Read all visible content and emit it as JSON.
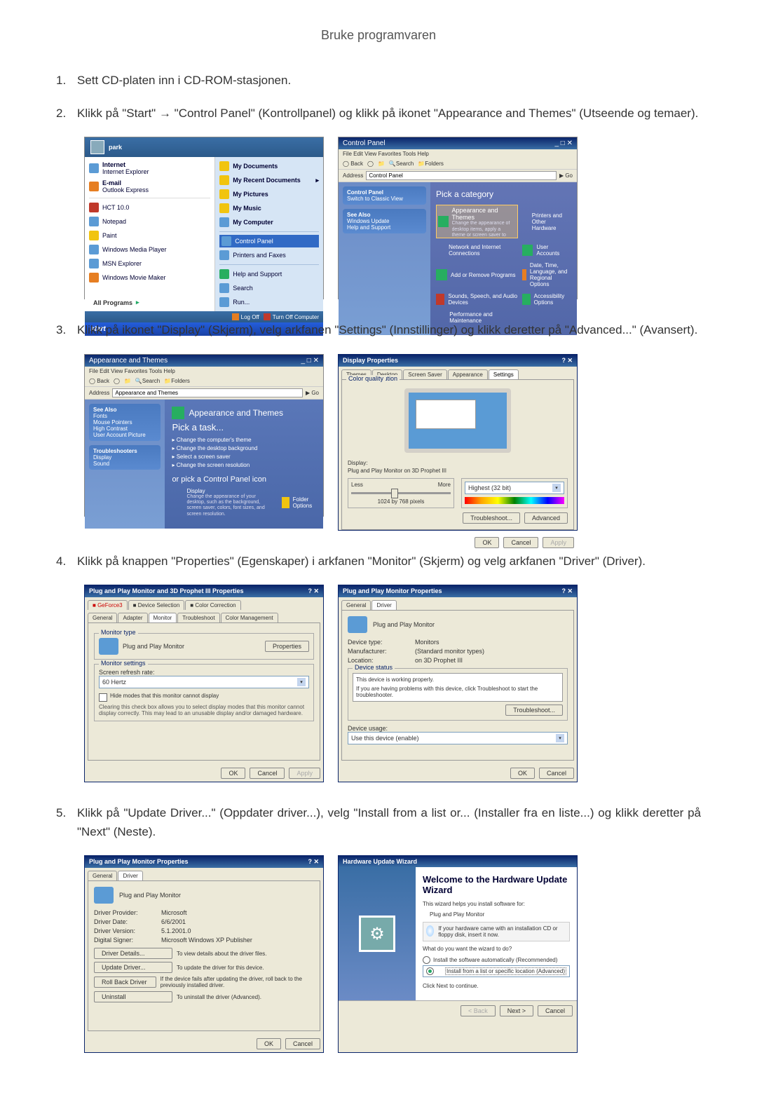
{
  "page_title": "Bruke programvaren",
  "steps": [
    {
      "num": "1.",
      "text": "Sett CD-platen inn i CD-ROM-stasjonen."
    },
    {
      "num": "2.",
      "text": "Klikk på \"Start\" → \"Control Panel\" (Kontrollpanel) og klikk på ikonet \"Appearance and Themes\" (Utseende og temaer)."
    },
    {
      "num": "3.",
      "text": "Klikk på ikonet \"Display\" (Skjerm), velg arkfanen \"Settings\" (Innstillinger) og klikk deretter på \"Advanced...\" (Avansert)."
    },
    {
      "num": "4.",
      "text": "Klikk på knappen \"Properties\" (Egenskaper) i arkfanen \"Monitor\" (Skjerm) og velg arkfanen \"Driver\" (Driver)."
    },
    {
      "num": "5.",
      "text": "Klikk på \"Update Driver...\" (Oppdater driver...), velg \"Install from a list or... (Installer fra en liste...) og klikk deretter på \"Next\" (Neste)."
    }
  ],
  "start_menu": {
    "user": "park",
    "left": [
      {
        "title": "Internet",
        "subtitle": "Internet Explorer"
      },
      {
        "title": "E-mail",
        "subtitle": "Outlook Express"
      },
      {
        "title": "HCT 10.0"
      },
      {
        "title": "Notepad"
      },
      {
        "title": "Paint"
      },
      {
        "title": "Windows Media Player"
      },
      {
        "title": "MSN Explorer"
      },
      {
        "title": "Windows Movie Maker"
      }
    ],
    "all_programs": "All Programs",
    "right": [
      "My Documents",
      "My Recent Documents",
      "My Pictures",
      "My Music",
      "My Computer",
      "Control Panel",
      "Printers and Faxes",
      "Help and Support",
      "Search",
      "Run..."
    ],
    "footer": {
      "logoff": "Log Off",
      "turnoff": "Turn Off Computer"
    },
    "taskbar": "start"
  },
  "control_panel": {
    "title": "Control Panel",
    "menubar": "File  Edit  View  Favorites  Tools  Help",
    "toolbar_back": "Back",
    "toolbar_search": "Search",
    "toolbar_folders": "Folders",
    "addr_label": "Address",
    "addr_value": "Control Panel",
    "addr_go": "Go",
    "side_heading": "Control Panel",
    "side_switch": "Switch to Classic View",
    "side_seealso": "See Also",
    "side_links": [
      "Windows Update",
      "Help and Support"
    ],
    "main_heading": "Pick a category",
    "categories": [
      "Appearance and Themes",
      "Printers and Other Hardware",
      "Network and Internet Connections",
      "User Accounts",
      "Add or Remove Programs",
      "Date, Time, Language, and Regional Options",
      "Sounds, Speech, and Audio Devices",
      "Accessibility Options",
      "Performance and Maintenance"
    ],
    "sel_desc": "Change the appearance of desktop items, apply a theme or screen saver to your computer, or customize the Start menu and taskbar."
  },
  "appearance": {
    "title": "Appearance and Themes",
    "task_head": "Pick a task...",
    "tasks": [
      "Change the computer's theme",
      "Change the desktop background",
      "Select a screen saver",
      "Change the screen resolution"
    ],
    "or_pick": "or pick a Control Panel icon",
    "icons": [
      "Display",
      "Folder Options"
    ],
    "display_desc": "Change the appearance of your desktop, such as the background, screen saver, colors, font sizes, and screen resolution.",
    "side_seealso": "See Also",
    "side_items": [
      "Fonts",
      "Mouse Pointers",
      "High Contrast",
      "User Account Picture"
    ],
    "side_ts_head": "Troubleshooters",
    "side_ts": [
      "Display",
      "Sound"
    ]
  },
  "display_props": {
    "title": "Display Properties",
    "tabs": [
      "Themes",
      "Desktop",
      "Screen Saver",
      "Appearance",
      "Settings"
    ],
    "active_tab": "Settings",
    "display_label": "Display:",
    "display_value": "Plug and Play Monitor on 3D Prophet III",
    "res_group": "Screen resolution",
    "res_less": "Less",
    "res_more": "More",
    "res_value": "1024 by 768 pixels",
    "color_group": "Color quality",
    "color_value": "Highest (32 bit)",
    "btn_trouble": "Troubleshoot...",
    "btn_adv": "Advanced",
    "btn_ok": "OK",
    "btn_cancel": "Cancel",
    "btn_apply": "Apply"
  },
  "monitor_props": {
    "title": "Plug and Play Monitor and 3D Prophet III Properties",
    "tabs_top": [
      "GeForce3",
      "Device Selection",
      "Color Correction"
    ],
    "tabs_bottom": [
      "General",
      "Adapter",
      "Monitor",
      "Troubleshoot",
      "Color Management"
    ],
    "active_tab": "Monitor",
    "mtype_group": "Monitor type",
    "mtype_value": "Plug and Play Monitor",
    "btn_props": "Properties",
    "msettings_group": "Monitor settings",
    "refresh_label": "Screen refresh rate:",
    "refresh_value": "60 Hertz",
    "hide_modes": "Hide modes that this monitor cannot display",
    "hide_desc": "Clearing this check box allows you to select display modes that this monitor cannot display correctly. This may lead to an unusable display and/or damaged hardware.",
    "btn_ok": "OK",
    "btn_cancel": "Cancel",
    "btn_apply": "Apply"
  },
  "pnp_props_general": {
    "title": "Plug and Play Monitor Properties",
    "tabs": [
      "General",
      "Driver"
    ],
    "active_tab": "Driver",
    "name": "Plug and Play Monitor",
    "devtype_label": "Device type:",
    "devtype_value": "Monitors",
    "manuf_label": "Manufacturer:",
    "manuf_value": "(Standard monitor types)",
    "loc_label": "Location:",
    "loc_value": "on 3D Prophet III",
    "status_group": "Device status",
    "status_text": "This device is working properly.",
    "status_help": "If you are having problems with this device, click Troubleshoot to start the troubleshooter.",
    "btn_trouble": "Troubleshoot...",
    "usage_label": "Device usage:",
    "usage_value": "Use this device (enable)",
    "btn_ok": "OK",
    "btn_cancel": "Cancel"
  },
  "pnp_props_driver": {
    "title": "Plug and Play Monitor Properties",
    "tabs": [
      "General",
      "Driver"
    ],
    "active_tab": "Driver",
    "name": "Plug and Play Monitor",
    "provider_label": "Driver Provider:",
    "provider_value": "Microsoft",
    "date_label": "Driver Date:",
    "date_value": "6/6/2001",
    "version_label": "Driver Version:",
    "version_value": "5.1.2001.0",
    "signer_label": "Digital Signer:",
    "signer_value": "Microsoft Windows XP Publisher",
    "btn_details": "Driver Details...",
    "btn_details_desc": "To view details about the driver files.",
    "btn_update": "Update Driver...",
    "btn_update_desc": "To update the driver for this device.",
    "btn_rollback": "Roll Back Driver",
    "btn_rollback_desc": "If the device fails after updating the driver, roll back to the previously installed driver.",
    "btn_uninstall": "Uninstall",
    "btn_uninstall_desc": "To uninstall the driver (Advanced).",
    "btn_ok": "OK",
    "btn_cancel": "Cancel"
  },
  "wizard": {
    "title": "Hardware Update Wizard",
    "welcome": "Welcome to the Hardware Update Wizard",
    "intro": "This wizard helps you install software for:",
    "device": "Plug and Play Monitor",
    "cd_hint": "If your hardware came with an installation CD or floppy disk, insert it now.",
    "question": "What do you want the wizard to do?",
    "opt_auto": "Install the software automatically (Recommended)",
    "opt_list": "Install from a list or specific location (Advanced)",
    "continue": "Click Next to continue.",
    "btn_back": "< Back",
    "btn_next": "Next >",
    "btn_cancel": "Cancel"
  }
}
